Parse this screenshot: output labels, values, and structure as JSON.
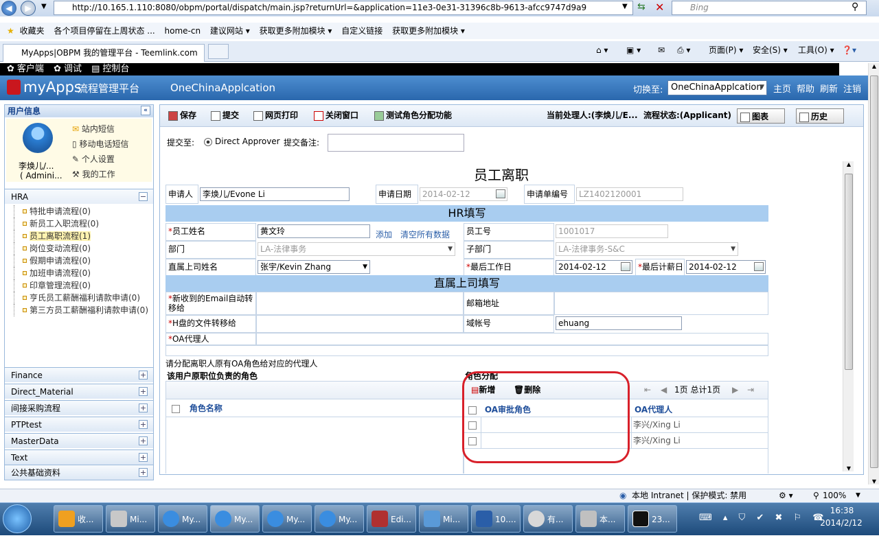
{
  "browser": {
    "url": "http://10.165.1.110:8080/obpm/portal/dispatch/main.jsp?returnUrl=&application=11e3-0e31-31396c8b-9613-afcc9747d9a9",
    "search_placeholder": "Bing",
    "favorites": [
      "收藏夹",
      "各个项目停留在上周状态 ...",
      "home-cn",
      "建议网站 ▾",
      "获取更多附加模块 ▾",
      "自定义链接",
      "获取更多附加模块 ▾"
    ],
    "tab_title": "MyApps|OBPM 我的管理平台 - Teemlink.com",
    "tools": [
      "页面(P) ▾",
      "安全(S) ▾",
      "工具(O) ▾"
    ]
  },
  "app_toolbar": [
    "客户端",
    "调试",
    "控制台"
  ],
  "header": {
    "logo": "myApps",
    "platform": "流程管理平台",
    "app_name": "OneChinaApplcation",
    "switch_label": "切换至:",
    "switch_value": "OneChinaApplcation",
    "links": [
      "主页",
      "帮助",
      "刷新",
      "注销"
    ]
  },
  "sidebar": {
    "user_info_title": "用户信息",
    "user_name": "李焕儿/...",
    "user_role": "( Admini...",
    "links": [
      "站内短信",
      "移动电话短信",
      "个人设置",
      "我的工作"
    ],
    "hra_title": "HRA",
    "hra_items": [
      "特批申请流程(0)",
      "新员工入职流程(0)",
      "员工离职流程(1)",
      "岗位变动流程(0)",
      "假期申请流程(0)",
      "加班申请流程(0)",
      "印章管理流程(0)",
      "亨氏员工薪酬福利请款申请(0)",
      "第三方员工薪酬福利请款申请(0)"
    ],
    "sections": [
      "Finance",
      "Direct_Material",
      "间接采购流程",
      "PTPtest",
      "MasterData",
      "Text",
      "公共基础资料"
    ]
  },
  "toolbar": {
    "save": "保存",
    "submit": "提交",
    "print": "网页打印",
    "close": "关闭窗口",
    "test_role": "测试角色分配功能",
    "current_handler": "当前处理人:(李焕儿/E...",
    "flow_status": "流程状态:(Applicant)",
    "chart": "图表",
    "history": "历史"
  },
  "submit_row": {
    "submit_to_label": "提交至:",
    "approver": "Direct Approver",
    "note_label": "提交备注:"
  },
  "form": {
    "title": "员工离职",
    "applicant_label": "申请人",
    "applicant": "李焕儿/Evone Li",
    "apply_date_label": "申请日期",
    "apply_date": "2014-02-12",
    "apply_no_label": "申请单编号",
    "apply_no": "LZ1402120001",
    "hr_section": "HR填写",
    "emp_name_label": "员工姓名",
    "emp_name": "黄文玲",
    "add_link": "添加",
    "clear_link": "清空所有数据",
    "emp_no_label": "员工号",
    "emp_no": "1001017",
    "dept_label": "部门",
    "dept": "LA-法律事务",
    "subdept_label": "子部门",
    "subdept": "LA-法律事务-S&C",
    "manager_label": "直属上司姓名",
    "manager": "张宇/Kevin Zhang",
    "last_workday_label": "最后工作日",
    "last_workday": "2014-02-12",
    "last_payday_label": "最后计薪日",
    "last_payday": "2014-02-12",
    "mgr_section": "直属上司填写",
    "email_forward_label": "新收到的Email自动转移给",
    "email_addr_label": "邮箱地址",
    "h_drive_label": "H盘的文件转移给",
    "domain_label": "域帐号",
    "domain": "ehuang",
    "oa_agent_label": "OA代理人",
    "assign_note": "请分配离职人原有OA角色给对应的代理人",
    "roles_title": "该用户原职位负责的角色",
    "role_assign_title": "角色分配",
    "role_name_col": "角色名称",
    "new_btn": "新增",
    "delete_btn": "删除",
    "pager": "1页 总计1页",
    "oa_role_col": "OA审批角色",
    "oa_agent_col": "OA代理人",
    "rows": [
      "李兴/Xing Li",
      "李兴/Xing Li"
    ]
  },
  "status": {
    "zone": "本地 Intranet | 保护模式: 禁用",
    "zoom": "100%"
  },
  "taskbar": {
    "items": [
      "收...",
      "Mi...",
      "My...",
      "My...",
      "My...",
      "My...",
      "Edi...",
      "Mi...",
      "10....",
      "有...",
      "本...",
      "23..."
    ],
    "time": "16:38",
    "date": "2014/2/12"
  }
}
